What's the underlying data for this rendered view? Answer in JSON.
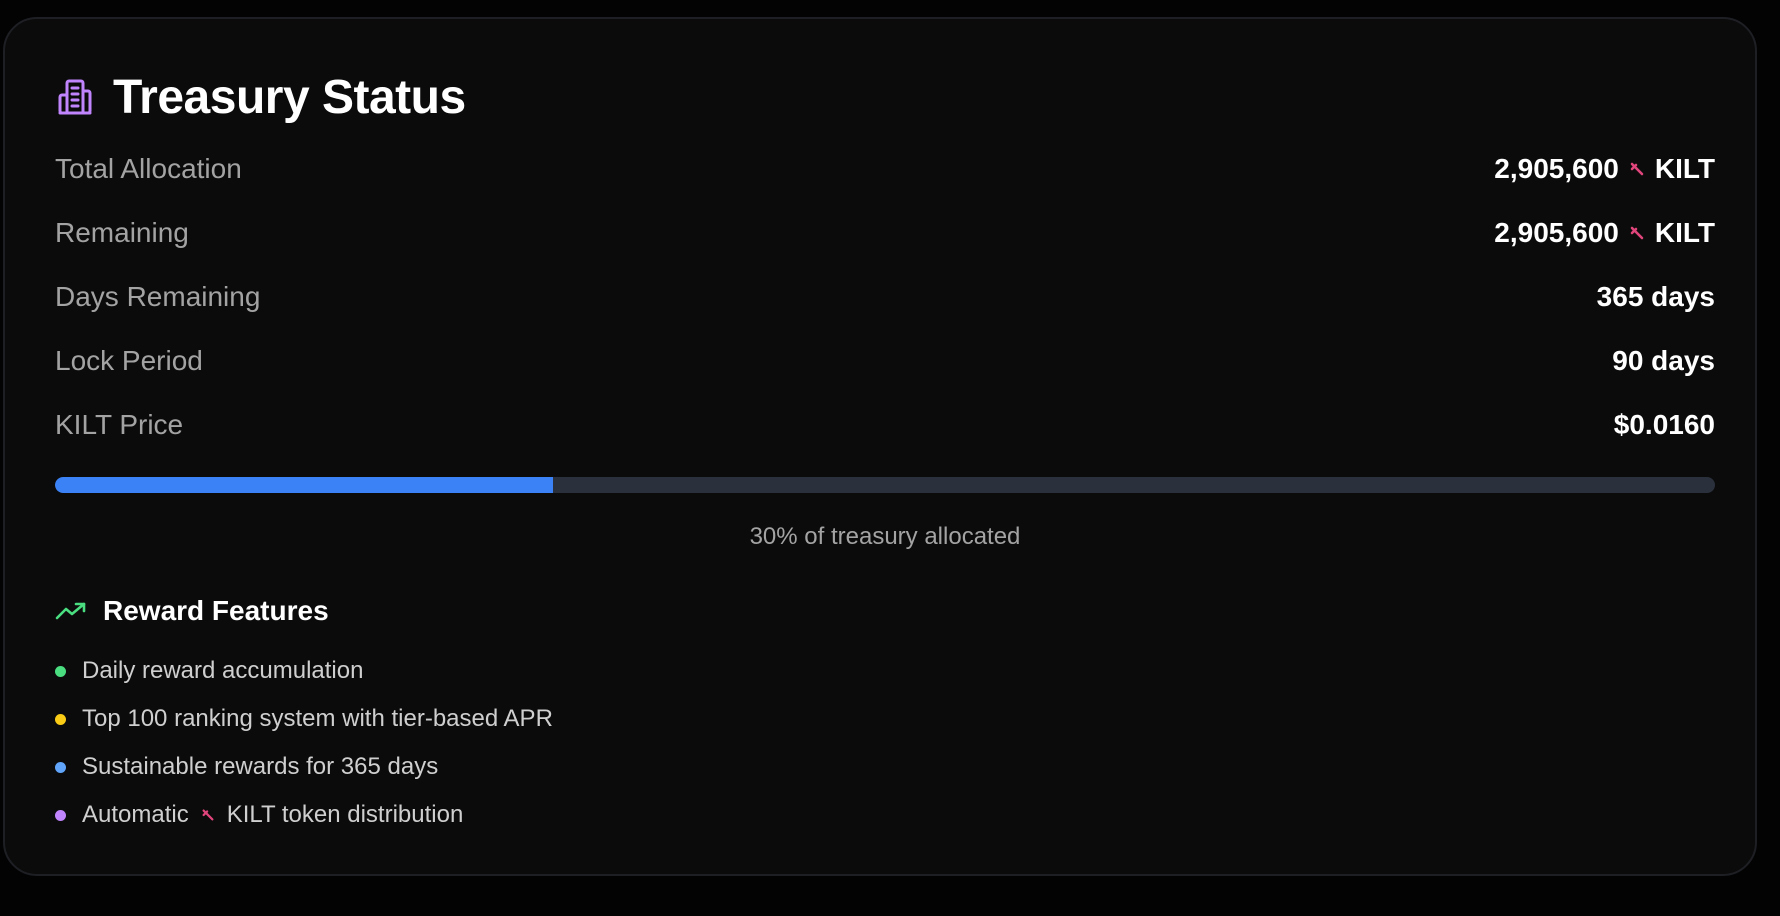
{
  "header": {
    "title": "Treasury Status",
    "icon": "building-icon",
    "icon_color": "#c084fc"
  },
  "stats": [
    {
      "label": "Total Allocation",
      "value": "2,905,600",
      "unit": "KILT",
      "has_token_mark": true
    },
    {
      "label": "Remaining",
      "value": "2,905,600",
      "unit": "KILT",
      "has_token_mark": true
    },
    {
      "label": "Days Remaining",
      "value": "365 days"
    },
    {
      "label": "Lock Period",
      "value": "90 days"
    },
    {
      "label": "KILT Price",
      "value": "$0.0160"
    }
  ],
  "progress": {
    "percent_allocated": 30,
    "caption": "30% of treasury allocated",
    "fill_color": "#3b82f6",
    "track_color": "#2a313c"
  },
  "features": {
    "title": "Reward Features",
    "icon": "trending-up-icon",
    "icon_color": "#4ade80",
    "items": [
      {
        "text": "Daily reward accumulation",
        "dot_color": "#4ade80"
      },
      {
        "text": "Top 100 ranking system with tier-based APR",
        "dot_color": "#facc15"
      },
      {
        "text": "Sustainable rewards for 365 days",
        "dot_color": "#60a5fa"
      },
      {
        "text_before": "Automatic",
        "text_after": "KILT token distribution",
        "dot_color": "#c084fc",
        "has_token_mark": true
      }
    ]
  },
  "token_mark_color": "#e0457b"
}
